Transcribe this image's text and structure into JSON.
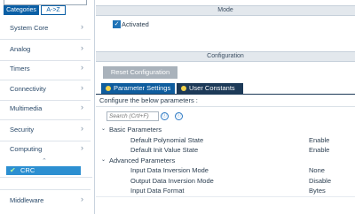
{
  "left_panel": {
    "tabs": {
      "categories": "Categories",
      "az": "A->Z"
    },
    "categories": [
      {
        "label": "System Core"
      },
      {
        "label": "Analog"
      },
      {
        "label": "Timers"
      },
      {
        "label": "Connectivity"
      },
      {
        "label": "Multimedia"
      },
      {
        "label": "Security"
      },
      {
        "label": "Computing"
      },
      {
        "label": "Middleware"
      }
    ],
    "selected_item": "CRC",
    "chevron": "›"
  },
  "right_panel": {
    "mode_header": "Mode",
    "activated_label": "Activated",
    "activated_checked": true,
    "configuration_header": "Configuration",
    "reset_button": "Reset Configuration",
    "tabs": {
      "parameter_settings": "Parameter Settings",
      "user_constants": "User Constants"
    },
    "configure_label": "Configure the below parameters :",
    "search_placeholder": "Search (Crtl+F)",
    "groups": [
      {
        "name": "Basic Parameters",
        "params": [
          {
            "name": "Default Polynomial State",
            "value": "Enable"
          },
          {
            "name": "Default Init Value State",
            "value": "Enable"
          }
        ]
      },
      {
        "name": "Advanced Parameters",
        "params": [
          {
            "name": "Input Data Inversion Mode",
            "value": "None"
          },
          {
            "name": "Output Data Inversion Mode",
            "value": "Disable"
          },
          {
            "name": "Input Data Format",
            "value": "Bytes"
          }
        ]
      }
    ]
  },
  "colors": {
    "accent": "#0b5fa5",
    "tab_dark": "#1d3a58",
    "selected": "#2c8fd1",
    "header_bg": "#e3e8ed"
  }
}
